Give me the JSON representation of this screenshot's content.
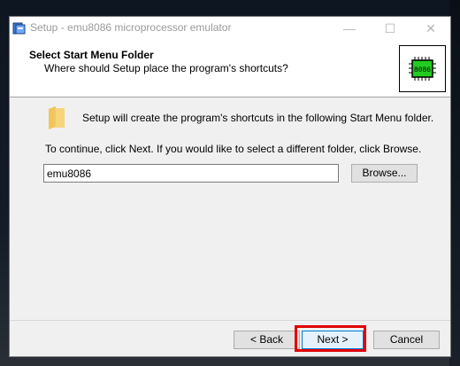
{
  "window": {
    "title": "Setup - emu8086 microprocessor emulator",
    "min_glyph": "—",
    "max_glyph": "☐",
    "close_glyph": "✕"
  },
  "header": {
    "title": "Select Start Menu Folder",
    "subtitle": "Where should Setup place the program's shortcuts?",
    "logo_label": "8086"
  },
  "body": {
    "intro": "Setup will create the program's shortcuts in the following Start Menu folder.",
    "continue": "To continue, click Next. If you would like to select a different folder, click Browse.",
    "folder_value": "emu8086",
    "browse_label": "Browse..."
  },
  "footer": {
    "back_label": "< Back",
    "next_label": "Next >",
    "cancel_label": "Cancel"
  },
  "colors": {
    "highlight": "#e00000",
    "accent": "#0078d7",
    "chip": "#22cc22"
  }
}
